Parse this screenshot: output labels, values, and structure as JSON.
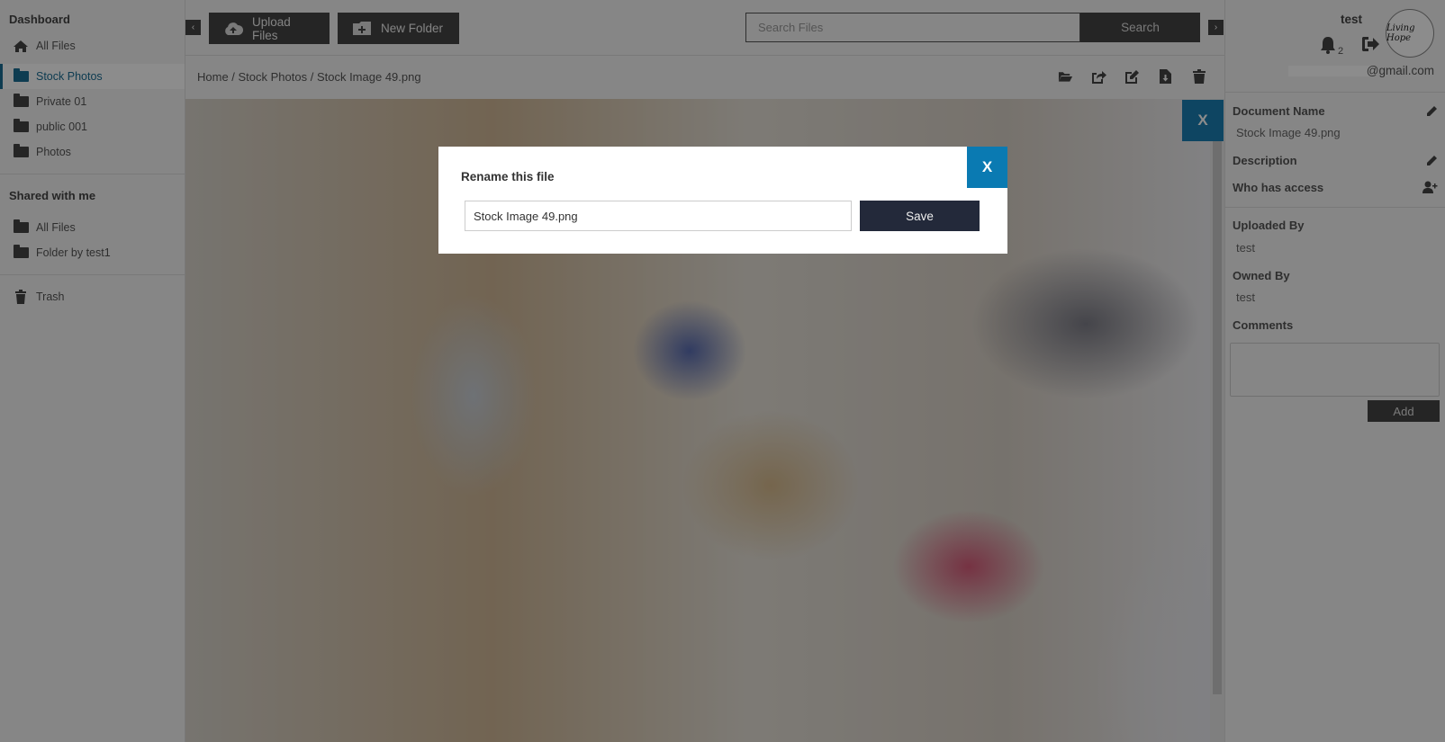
{
  "sidebar": {
    "dashboard_title": "Dashboard",
    "my_items": [
      {
        "label": "All Files",
        "icon": "home-icon",
        "active": false
      },
      {
        "label": "Stock Photos",
        "icon": "folder-icon",
        "active": true
      },
      {
        "label": "Private 01",
        "icon": "folder-icon",
        "active": false
      },
      {
        "label": "public 001",
        "icon": "folder-icon",
        "active": false
      },
      {
        "label": "Photos",
        "icon": "folder-icon",
        "active": false
      }
    ],
    "shared_title": "Shared with me",
    "shared_items": [
      {
        "label": "All Files",
        "icon": "folder-icon"
      },
      {
        "label": "Folder by test1",
        "icon": "folder-icon"
      }
    ],
    "trash_label": "Trash"
  },
  "toolbar": {
    "collapse_left": "‹",
    "collapse_right": "›",
    "upload_label": "Upload Files",
    "new_folder_label": "New Folder",
    "search_placeholder": "Search Files",
    "search_label": "Search"
  },
  "breadcrumb": "Home / Stock Photos / Stock Image 49.png",
  "file_actions": [
    "open-folder-icon",
    "share-icon",
    "edit-icon",
    "download-icon",
    "trash-icon"
  ],
  "preview": {
    "close_label": "X"
  },
  "user": {
    "name": "test",
    "notification_count": "2",
    "email_visible": "@gmail.com",
    "avatar_text": "Living Hope"
  },
  "details": {
    "document_name_label": "Document Name",
    "document_name_value": "Stock Image 49.png",
    "description_label": "Description",
    "access_label": "Who has access",
    "uploaded_by_label": "Uploaded By",
    "uploaded_by_value": "test",
    "owned_by_label": "Owned By",
    "owned_by_value": "test",
    "comments_label": "Comments",
    "comments_value": "",
    "add_label": "Add"
  },
  "modal": {
    "title": "Rename this file",
    "input_value": "Stock Image 49.png",
    "save_label": "Save",
    "close_label": "X"
  },
  "colors": {
    "accent": "#1a7fb2",
    "save_button": "#23293a",
    "dark_button": "#444444"
  }
}
